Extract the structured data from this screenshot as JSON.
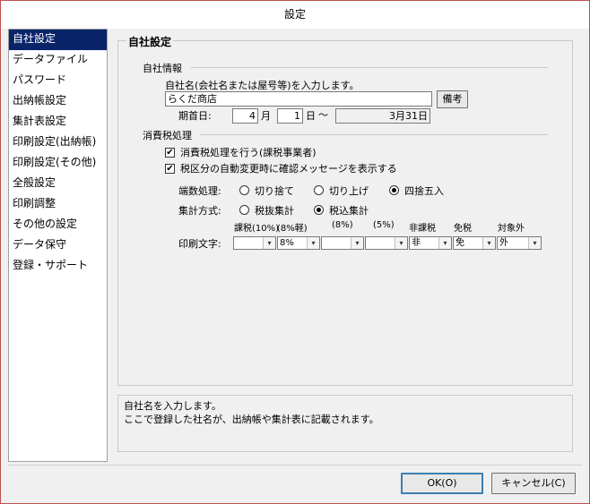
{
  "window": {
    "title": "設定"
  },
  "sidebar": {
    "items": [
      {
        "label": "自社設定",
        "selected": true
      },
      {
        "label": "データファイル"
      },
      {
        "label": "パスワード"
      },
      {
        "label": "出納帳設定"
      },
      {
        "label": "集計表設定"
      },
      {
        "label": "印刷設定(出納帳)"
      },
      {
        "label": "印刷設定(その他)"
      },
      {
        "label": "全般設定"
      },
      {
        "label": "印刷調整"
      },
      {
        "label": "その他の設定"
      },
      {
        "label": "データ保守"
      },
      {
        "label": "登録・サポート"
      }
    ]
  },
  "panel": {
    "title": "自社設定",
    "company": {
      "section": "自社情報",
      "prompt": "自社名(会社名または屋号等)を入力します。",
      "name_value": "らくだ商店",
      "notes_button": "備考",
      "fiscal_label": "期首日:",
      "month_value": "4",
      "month_unit": "月",
      "day_value": "1",
      "day_unit": "日",
      "tilde": "〜",
      "end_value": "3月31日"
    },
    "tax": {
      "section": "消費税処理",
      "check1": {
        "label": "消費税処理を行う(課税事業者)",
        "checked": true
      },
      "check2": {
        "label": "税区分の自動変更時に確認メッセージを表示する",
        "checked": true
      },
      "rounding_label": "端数処理:",
      "rounding_options": [
        "切り捨て",
        "切り上げ",
        "四捨五入"
      ],
      "rounding_selected": 2,
      "method_label": "集計方式:",
      "method_options": [
        "税抜集計",
        "税込集計"
      ],
      "method_selected": 1,
      "print_label": "印刷文字:",
      "columns": [
        {
          "header": "課税(10%)",
          "value": ""
        },
        {
          "header": "(8%軽)",
          "value": "8%"
        },
        {
          "header": "(8%)",
          "value": ""
        },
        {
          "header": "(5%)",
          "value": ""
        },
        {
          "header": "非課税",
          "value": "非"
        },
        {
          "header": "免税",
          "value": "免"
        },
        {
          "header": "対象外",
          "value": "外"
        }
      ]
    }
  },
  "description": {
    "line1": "自社名を入力します。",
    "line2": "ここで登録した社名が、出納帳や集計表に記載されます。"
  },
  "footer": {
    "ok": "OK(O)",
    "cancel": "キャンセル(C)"
  }
}
